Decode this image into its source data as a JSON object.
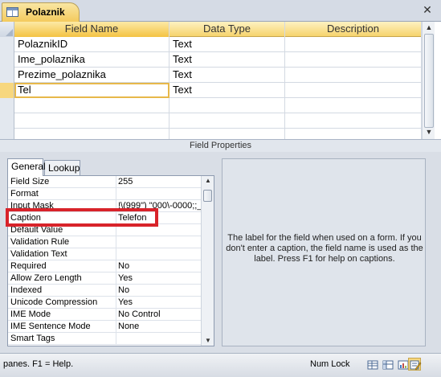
{
  "tab": {
    "title": "Polaznik"
  },
  "grid": {
    "headers": [
      "Field Name",
      "Data Type",
      "Description"
    ],
    "rows": [
      {
        "name": "PolaznikID",
        "type": "Text",
        "desc": ""
      },
      {
        "name": "Ime_polaznika",
        "type": "Text",
        "desc": ""
      },
      {
        "name": "Prezime_polaznika",
        "type": "Text",
        "desc": ""
      },
      {
        "name": "Tel",
        "type": "Text",
        "desc": ""
      }
    ]
  },
  "field_properties": {
    "title": "Field Properties",
    "tabs": [
      "General",
      "Lookup"
    ],
    "rows": [
      {
        "label": "Field Size",
        "value": "255"
      },
      {
        "label": "Format",
        "value": ""
      },
      {
        "label": "Input Mask",
        "value": "!\\(999\") \"000\\-0000;;_"
      },
      {
        "label": "Caption",
        "value": "Telefon"
      },
      {
        "label": "Default Value",
        "value": ""
      },
      {
        "label": "Validation Rule",
        "value": ""
      },
      {
        "label": "Validation Text",
        "value": ""
      },
      {
        "label": "Required",
        "value": "No"
      },
      {
        "label": "Allow Zero Length",
        "value": "Yes"
      },
      {
        "label": "Indexed",
        "value": "No"
      },
      {
        "label": "Unicode Compression",
        "value": "Yes"
      },
      {
        "label": "IME Mode",
        "value": "No Control"
      },
      {
        "label": "IME Sentence Mode",
        "value": "None"
      },
      {
        "label": "Smart Tags",
        "value": ""
      }
    ],
    "help_text": "The label for the field when used on a form. If you don't enter a caption, the field name is used as the label. Press F1 for help on captions."
  },
  "status": {
    "text": "panes.  F1 = Help.",
    "numlock": "Num Lock"
  },
  "colors": {
    "highlight": "#d8232a",
    "header_active": "#f4c343"
  }
}
